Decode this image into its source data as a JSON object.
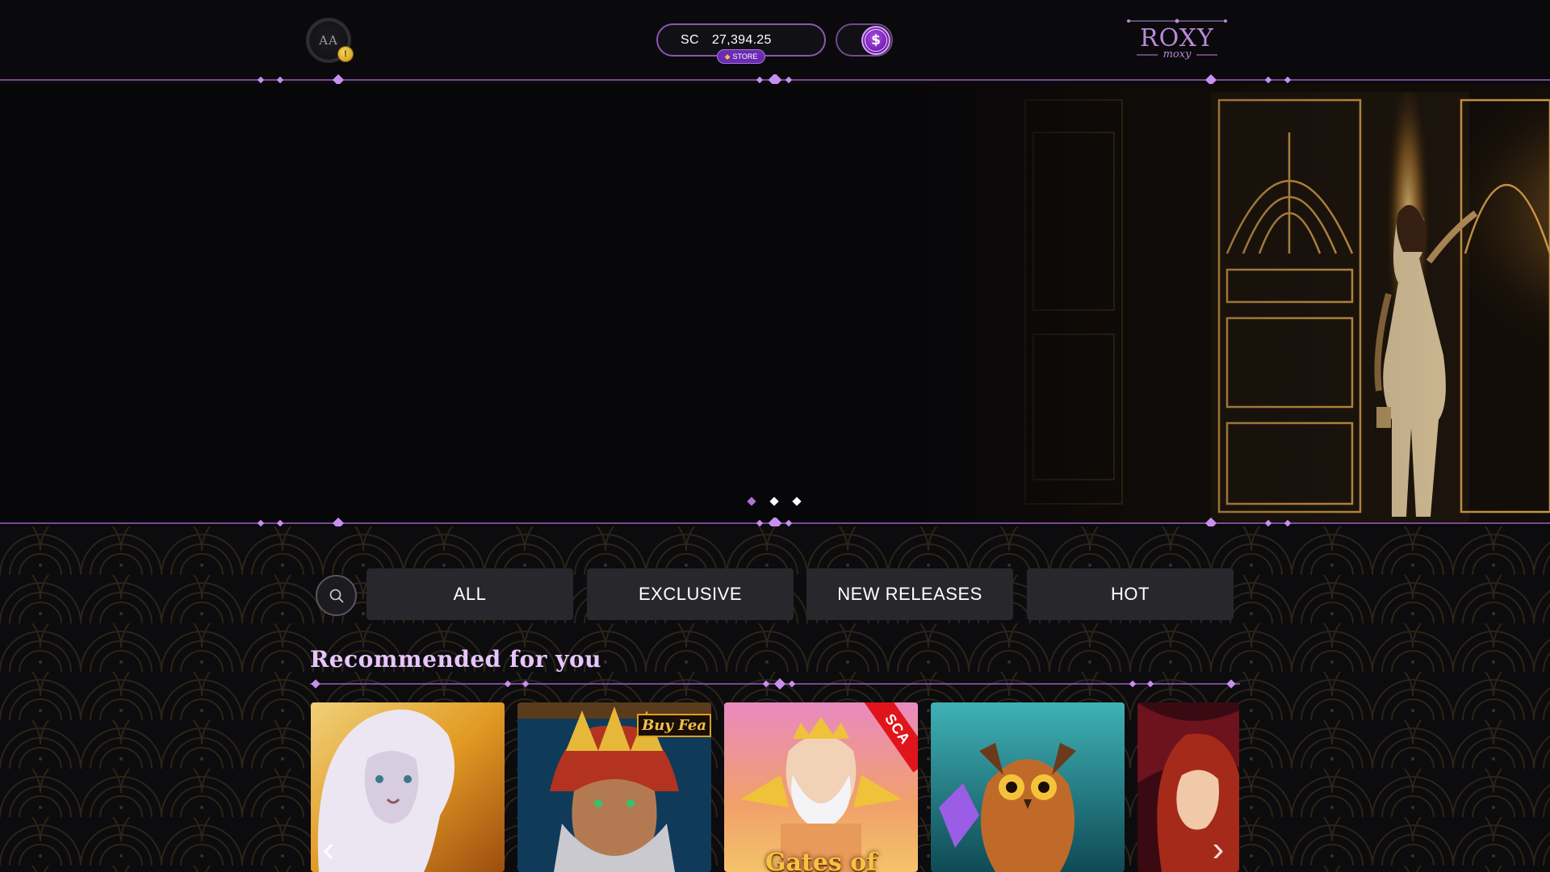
{
  "header": {
    "avatar_initials": "AA",
    "avatar_badge": "!",
    "balance": {
      "currency": "SC",
      "amount": "27,394.25",
      "store_label": "STORE"
    },
    "coin_symbol": "$",
    "logo": {
      "main": "ROXY",
      "sub": "moxy"
    }
  },
  "hero": {
    "slides": 3,
    "active_slide": 2
  },
  "filters": {
    "tabs": [
      {
        "label": "ALL"
      },
      {
        "label": "EXCLUSIVE"
      },
      {
        "label": "NEW RELEASES"
      },
      {
        "label": "HOT"
      }
    ]
  },
  "recommended": {
    "title": "Recommended for you",
    "games": [
      {
        "art": "white-lion"
      },
      {
        "art": "tribal-elder",
        "badge": "Buy Fea"
      },
      {
        "art": "zeus",
        "title_art": "Gates of",
        "badge": "SCA"
      },
      {
        "art": "owl"
      },
      {
        "art": "red-haired-woman"
      }
    ]
  },
  "colors": {
    "accent": "#b879e0",
    "background": "#0a090c",
    "tab_bg": "#28272b",
    "title": "#e7c6ff"
  },
  "icons": {
    "search": "search-icon",
    "prev": "chevron-left-icon",
    "next": "chevron-right-icon"
  }
}
